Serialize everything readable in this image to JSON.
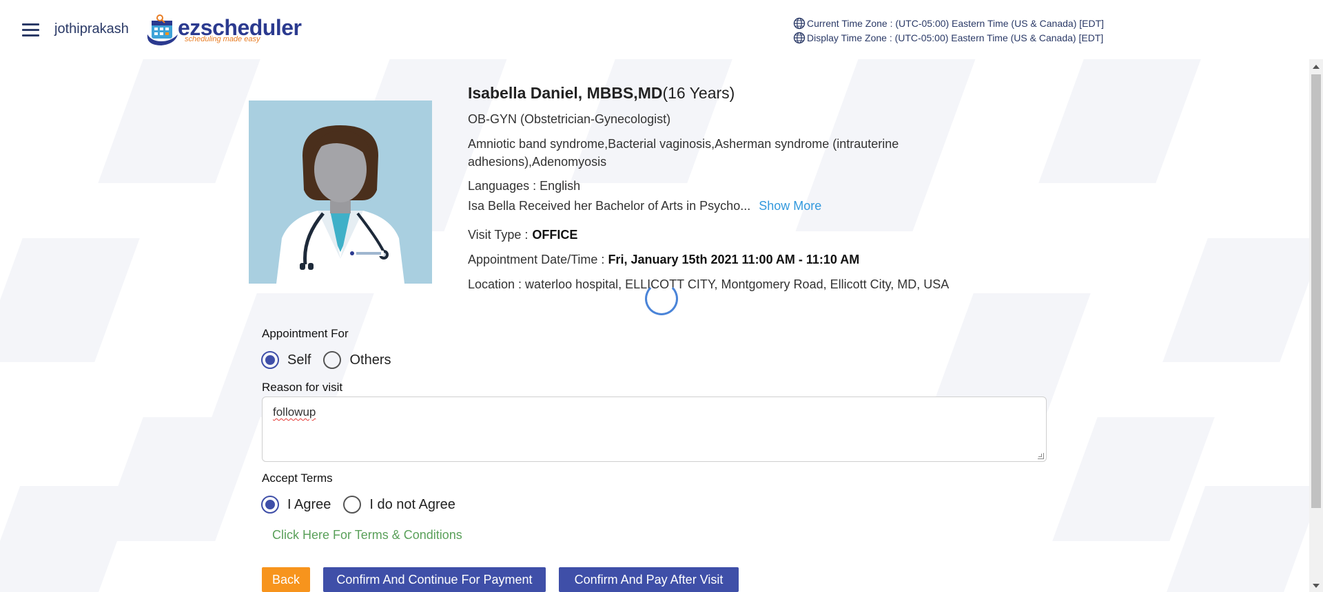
{
  "header": {
    "username": "jothiprakash",
    "logo_text": "ezscheduler",
    "logo_tagline": "scheduling made easy",
    "current_tz": "Current Time Zone : (UTC-05:00) Eastern Time (US & Canada) [EDT]",
    "display_tz": "Display Time Zone : (UTC-05:00) Eastern Time (US & Canada) [EDT]"
  },
  "doctor": {
    "name": "Isabella Daniel, MBBS,MD",
    "experience": "(16 Years)",
    "specialty": "OB-GYN (Obstetrician-Gynecologist)",
    "conditions": "Amniotic band syndrome,Bacterial vaginosis,Asherman syndrome (intrauterine adhesions),Adenomyosis",
    "languages": "Languages : English",
    "bio": "Isa Bella Received her Bachelor of Arts in Psycho...",
    "show_more": "Show More",
    "visit_type_label": "Visit Type :",
    "visit_type": "OFFICE",
    "appt_label": "Appointment Date/Time :",
    "appt_value": "Fri, January 15th 2021 11:00 AM - 11:10 AM",
    "location": "Location : waterloo hospital, ELLICOTT CITY, Montgomery Road, Ellicott City, MD, USA"
  },
  "form": {
    "appointment_for_label": "Appointment For",
    "option_self": "Self",
    "option_others": "Others",
    "selected_for": "Self",
    "reason_label": "Reason for visit",
    "reason_value": "followup",
    "terms_label": "Accept Terms",
    "option_agree": "I Agree",
    "option_disagree": "I do not Agree",
    "selected_terms": "I Agree",
    "terms_link": "Click Here For Terms & Conditions"
  },
  "buttons": {
    "back": "Back",
    "confirm_payment": "Confirm And Continue For Payment",
    "confirm_later": "Confirm And Pay After Visit"
  },
  "colors": {
    "primary": "#3f4fa8",
    "back_button": "#f7941d",
    "link_blue": "#3399dd",
    "terms_green": "#5aa05a"
  },
  "icons": {
    "menu": "hamburger-menu-icon",
    "globe": "globe-icon",
    "spinner": "loading-spinner-icon"
  }
}
